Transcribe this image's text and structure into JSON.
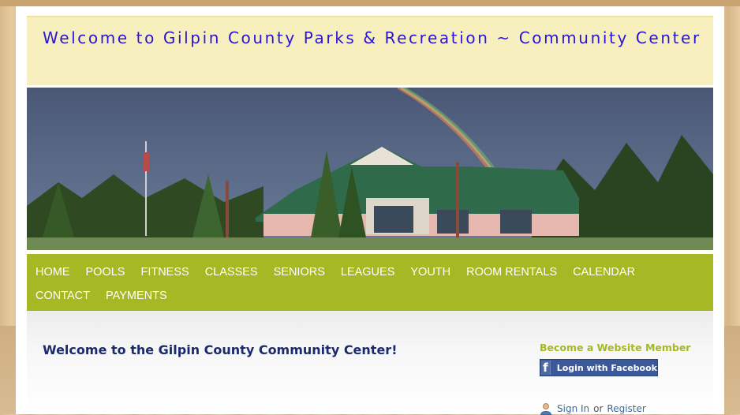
{
  "header": {
    "site_title": "Welcome to Gilpin County Parks & Recreation ~ Community Center"
  },
  "banner": {
    "image_description_icon": "building-photo"
  },
  "nav": {
    "items": [
      {
        "label": "HOME"
      },
      {
        "label": "POOLS"
      },
      {
        "label": "FITNESS"
      },
      {
        "label": "CLASSES"
      },
      {
        "label": "SENIORS"
      },
      {
        "label": "LEAGUES"
      },
      {
        "label": "YOUTH"
      },
      {
        "label": "ROOM RENTALS"
      },
      {
        "label": "CALENDAR"
      },
      {
        "label": "CONTACT"
      },
      {
        "label": "PAYMENTS"
      }
    ]
  },
  "main": {
    "heading": "Welcome to the Gilpin County Community Center!"
  },
  "sidebar": {
    "member_title": "Become a Website Member",
    "facebook_login": "Login with Facebook",
    "sign_in": "Sign In",
    "or": "or",
    "register": "Register"
  },
  "colors": {
    "nav_bg": "#a6b824",
    "header_bg": "#f7efbd",
    "title_color": "#2a14d8",
    "heading_color": "#1a2a6a",
    "facebook_blue": "#3b5998"
  }
}
